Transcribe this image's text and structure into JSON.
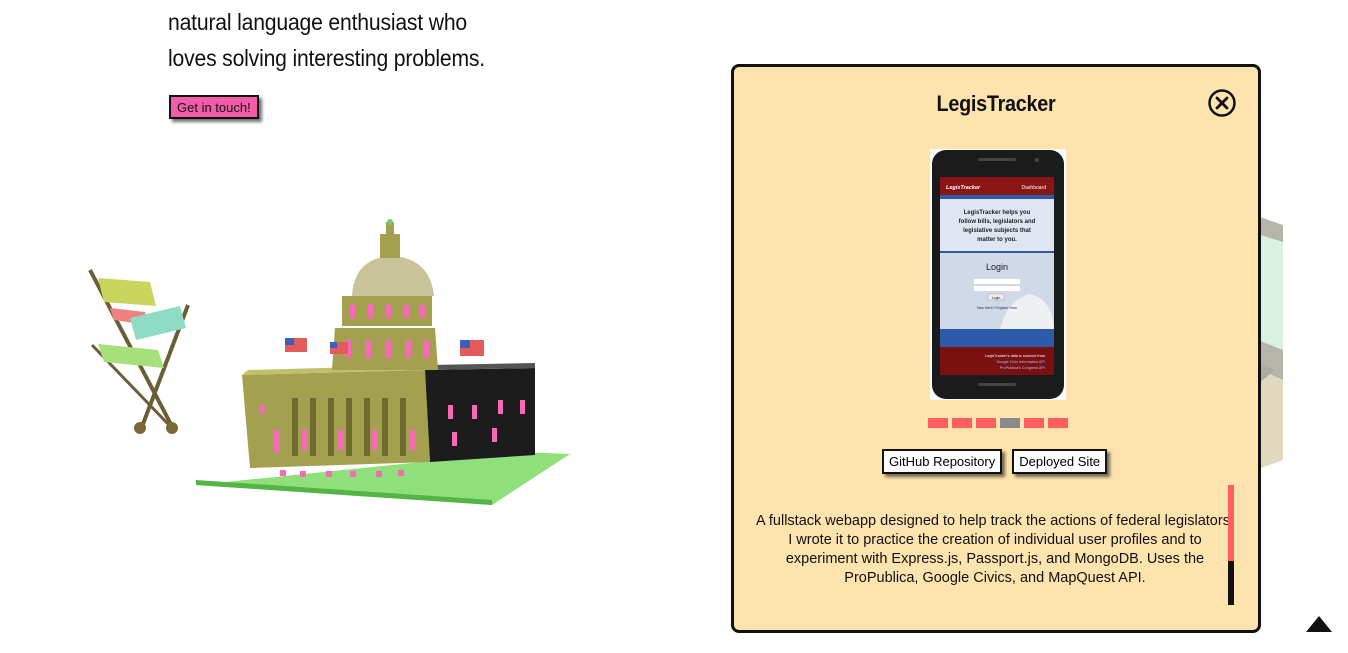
{
  "intro": {
    "line1": "natural language enthusiast who",
    "line2": "loves solving interesting problems."
  },
  "cta": {
    "label": "Get in touch!"
  },
  "modal": {
    "title": "LegisTracker",
    "close_icon": "close-circle-icon",
    "screenshot_alt": "LegisTracker mobile screenshot",
    "phone_screen": {
      "brand": "LegisTracker",
      "nav": "Dashboard",
      "tagline1": "LegisTracker helps you",
      "tagline2": "follow bills, legislators and",
      "tagline3": "legislative subjects that",
      "tagline4": "matter to you.",
      "login_heading": "Login",
      "login_button": "Login",
      "signup": "New Here? Register Here",
      "footer1": "LegisTracker's data is sourced from",
      "footer2": "Google Civic Information API",
      "footer3": "ProPublica's Congress API"
    },
    "carousel": {
      "count": 6,
      "active_index": 3
    },
    "github_label": "GitHub Repository",
    "deployed_label": "Deployed Site",
    "description": "A fullstack webapp designed to help track the actions of federal legislators. I wrote it to practice the creation of individual user profiles and to experiment with Express.js, Passport.js, and MongoDB. Uses the ProPublica, Google Civics, and MapQuest API.",
    "scroll_position": 0.63
  },
  "back_to_top_icon": "triangle-up-icon",
  "colors": {
    "accent_pink": "#f45ba9",
    "modal_bg": "#fde3ad",
    "carousel_red": "#ff5f5f",
    "carousel_active": "#8a8a8a",
    "capitol_gold": "#a3a04f",
    "lawn_green": "#8fe07a"
  }
}
